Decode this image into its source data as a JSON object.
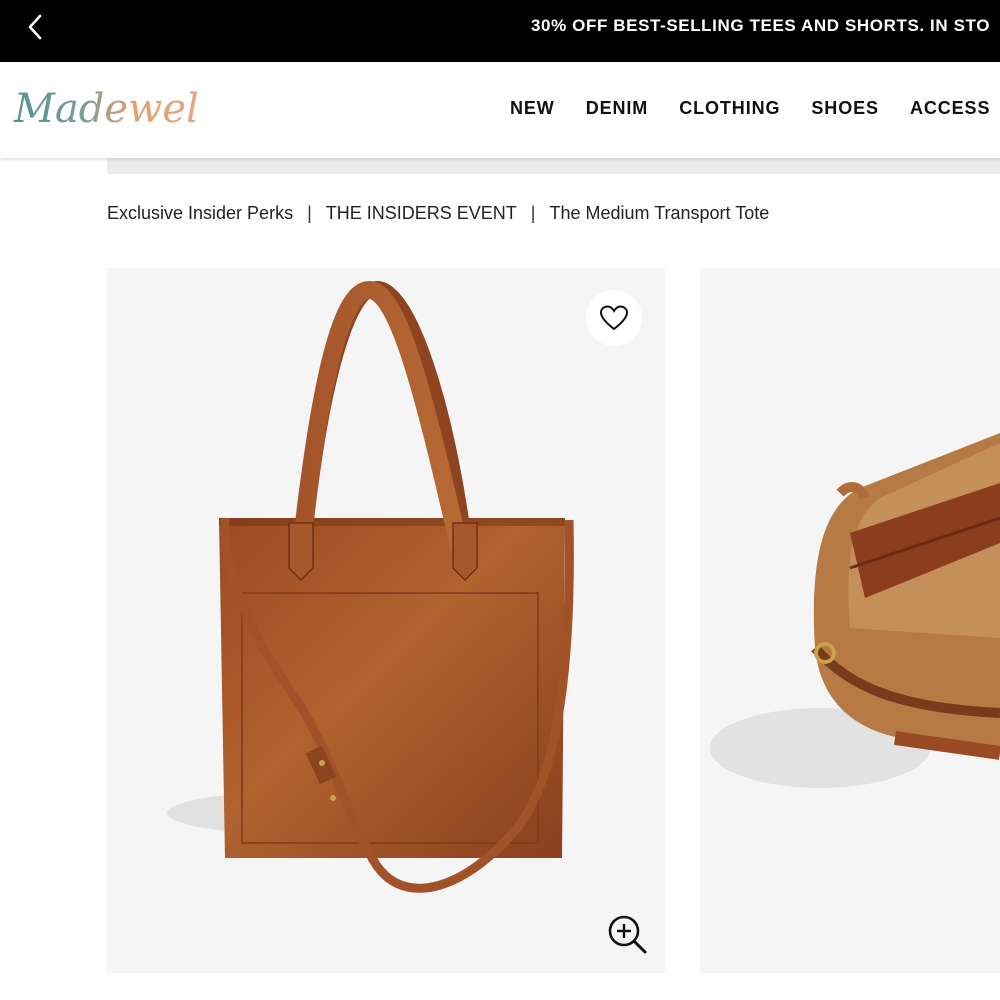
{
  "promo": {
    "message": "30% OFF BEST-SELLING TEES AND SHORTS. IN STO",
    "back_icon": "chevron-left-icon"
  },
  "header": {
    "logo_text": "Madewell",
    "nav": [
      "NEW",
      "DENIM",
      "CLOTHING",
      "SHOES",
      "ACCESS"
    ]
  },
  "breadcrumb": {
    "items": [
      "Exclusive Insider Perks",
      "THE INSIDERS EVENT",
      "The Medium Transport Tote"
    ],
    "separator": "|"
  },
  "product": {
    "images": [
      "brown leather tote bag front view",
      "brown leather tote bag interior view"
    ],
    "wishlist_icon": "heart-icon",
    "zoom_icon": "zoom-in-icon"
  },
  "colors": {
    "promo_bg": "#000000",
    "leather": "#a5552c",
    "image_bg": "#f5f5f5"
  }
}
